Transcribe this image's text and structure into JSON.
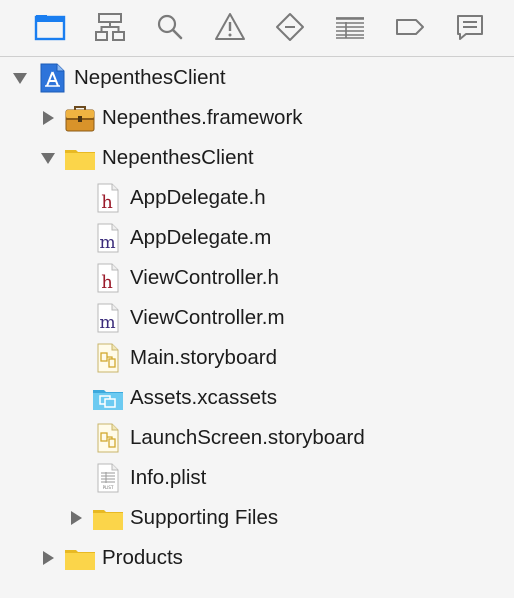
{
  "toolbar": {
    "buttons": [
      {
        "icon": "folder-icon",
        "active": true
      },
      {
        "icon": "hierarchy-icon",
        "active": false
      },
      {
        "icon": "search-icon",
        "active": false
      },
      {
        "icon": "warning-icon",
        "active": false
      },
      {
        "icon": "diamond-test-icon",
        "active": false
      },
      {
        "icon": "list-grid-icon",
        "active": false
      },
      {
        "icon": "tag-icon",
        "active": false
      },
      {
        "icon": "comment-icon",
        "active": false
      }
    ],
    "active_color": "#1a7ef0",
    "inactive_color": "#7a7a7a"
  },
  "tree": {
    "project": {
      "label": "NepenthesClient",
      "icon": "xcode-project-icon",
      "expanded": true
    },
    "items": [
      {
        "label": "Nepenthes.framework",
        "icon": "framework-toolbox-icon",
        "expanded": false
      },
      {
        "label": "NepenthesClient",
        "icon": "folder-icon",
        "expanded": true
      },
      {
        "label": "AppDelegate.h",
        "icon": "header-file-icon",
        "letter": "h"
      },
      {
        "label": "AppDelegate.m",
        "icon": "objc-source-file-icon",
        "letter": "m"
      },
      {
        "label": "ViewController.h",
        "icon": "header-file-icon",
        "letter": "h"
      },
      {
        "label": "ViewController.m",
        "icon": "objc-source-file-icon",
        "letter": "m"
      },
      {
        "label": "Main.storyboard",
        "icon": "storyboard-file-icon"
      },
      {
        "label": "Assets.xcassets",
        "icon": "asset-catalog-icon"
      },
      {
        "label": "LaunchScreen.storyboard",
        "icon": "storyboard-file-icon"
      },
      {
        "label": "Info.plist",
        "icon": "plist-file-icon",
        "badge": "PLIST"
      },
      {
        "label": "Supporting Files",
        "icon": "folder-icon",
        "expanded": false
      },
      {
        "label": "Products",
        "icon": "folder-icon",
        "expanded": false
      }
    ]
  },
  "colors": {
    "folder_yellow": "#f9cd2f",
    "header_letter": "#9b1b2b",
    "source_letter": "#3a2b7a",
    "asset_blue": "#5cc2ef"
  }
}
